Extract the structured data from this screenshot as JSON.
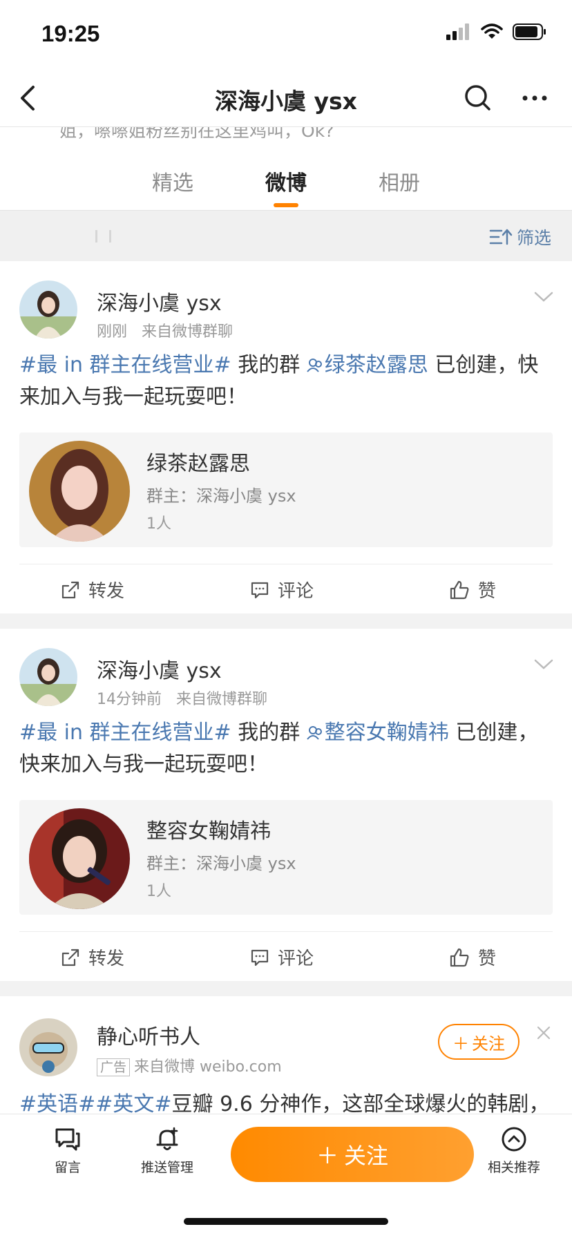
{
  "status_bar": {
    "time": "19:25"
  },
  "header": {
    "title": "深海小虞 ysx"
  },
  "scrolled_bio_text": "姐，嚓嚓姐粉丝别在这里鸡叫，Ok?",
  "tabs": [
    {
      "label": "精选",
      "active": false
    },
    {
      "label": "微博",
      "active": true
    },
    {
      "label": "相册",
      "active": false
    }
  ],
  "filter": {
    "label": "筛选"
  },
  "posts": [
    {
      "author": "深海小虞 ysx",
      "time": "刚刚",
      "source": "来自微博群聊",
      "topic": "#最 in 群主在线营业#",
      "text_before": " 我的群 ",
      "group_link": "绿茶赵露思",
      "text_after": " 已创建，快来加入与我一起玩耍吧！",
      "card": {
        "name": "绿茶赵露思",
        "owner": "群主：深海小虞 ysx",
        "count": "1人"
      },
      "actions": {
        "repost": "转发",
        "comment": "评论",
        "like": "赞"
      }
    },
    {
      "author": "深海小虞 ysx",
      "time": "14分钟前",
      "source": "来自微博群聊",
      "topic": "#最 in 群主在线营业#",
      "text_before": " 我的群 ",
      "group_link": "整容女鞠婧祎",
      "text_after": " 已创建，快来加入与我一起玩耍吧！",
      "card": {
        "name": "整容女鞠婧祎",
        "owner": "群主：深海小虞 ysx",
        "count": "1人"
      },
      "actions": {
        "repost": "转发",
        "comment": "评论",
        "like": "赞"
      }
    }
  ],
  "ad_post": {
    "author": "静心听书人",
    "ad_tag": "广告",
    "source": "来自微博 weibo.com",
    "follow": "关注",
    "topics": "#英语##英文#",
    "text": "豆瓣 9.6 分神作，这部全球爆火的韩剧，"
  },
  "bottom_bar": {
    "message": "留言",
    "push": "推送管理",
    "follow": "关注",
    "related": "相关推荐"
  },
  "colors": {
    "accent": "#ff8200",
    "link": "#4a78b0"
  }
}
